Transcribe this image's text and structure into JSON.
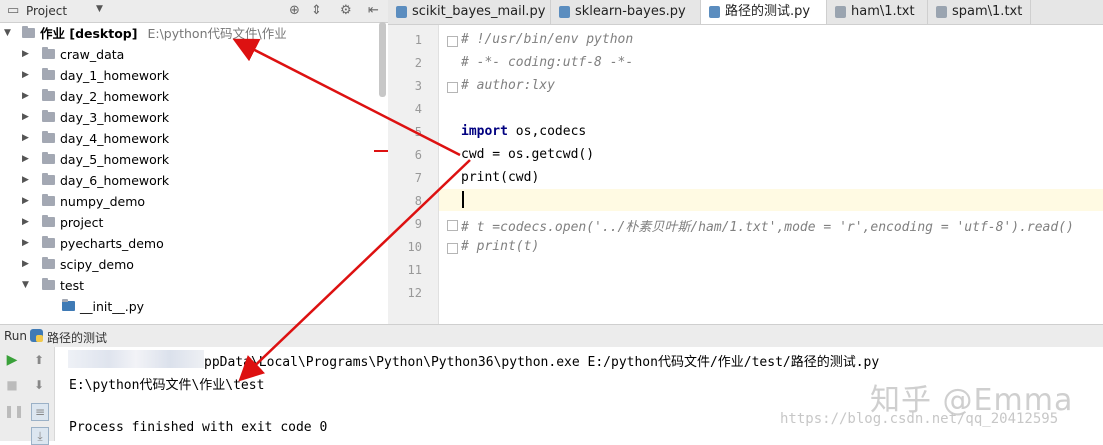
{
  "project_panel": {
    "title": "Project",
    "root": {
      "name": "作业 [desktop]",
      "path": "E:\\python代码文件\\作业"
    },
    "folders": [
      "craw_data",
      "day_1_homework",
      "day_2_homework",
      "day_3_homework",
      "day_4_homework",
      "day_5_homework",
      "day_6_homework",
      "numpy_demo",
      "project",
      "pyecharts_demo",
      "scipy_demo",
      "test"
    ],
    "test_child": "__init__.py"
  },
  "tabs": [
    {
      "label": "scikit_bayes_mail.py"
    },
    {
      "label": "sklearn-bayes.py"
    },
    {
      "label": "路径的测试.py",
      "active": true
    },
    {
      "label": "ham\\1.txt"
    },
    {
      "label": "spam\\1.txt"
    }
  ],
  "editor": {
    "line_numbers": [
      "1",
      "2",
      "3",
      "4",
      "5",
      "6",
      "7",
      "8",
      "9",
      "10",
      "11",
      "12"
    ],
    "lines": {
      "l1": "# !/usr/bin/env python",
      "l2": "# -*- coding:utf-8 -*-",
      "l3": "# author:lxy",
      "l5_kw": "import",
      "l5_rest": " os,codecs",
      "l6": "cwd = os.getcwd()",
      "l7": "print(cwd)",
      "l9": "# t =codecs.open('../朴素贝叶斯/ham/1.txt',mode = 'r',encoding = 'utf-8').read()",
      "l10": "# print(t)"
    }
  },
  "run_panel": {
    "label": "Run",
    "config_name": "路径的测试",
    "command": "ppData\\Local\\Programs\\Python\\Python36\\python.exe E:/python代码文件/作业/test/路径的测试.py",
    "output": "E:\\python代码文件\\作业\\test",
    "exit_message": "Process finished with exit code 0"
  },
  "watermark": {
    "brand": "知乎 @Emma",
    "url": "https://blog.csdn.net/qq_20412595"
  },
  "colors": {
    "annotation_arrow": "#dd1111",
    "current_line": "#fffae3",
    "keyword": "#000080",
    "comment": "#808080"
  }
}
